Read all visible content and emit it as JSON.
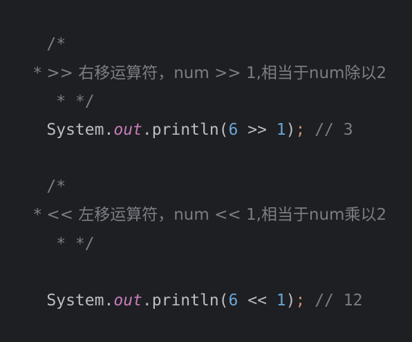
{
  "editor": {
    "lines": [
      {
        "text": "/*"
      },
      {
        "text": " * >> 右移运算符，num >> 1,相当于num除以2"
      },
      {
        "text": " * */"
      },
      {
        "tokens": {
          "cls": "System",
          "dot1": ".",
          "field": "out",
          "dot2": ".",
          "method": "println(",
          "n1": "6",
          "op": " >> ",
          "n2": "1",
          "close": ")",
          "semi": ";",
          "comment": " // 3"
        }
      },
      {
        "text": "/*"
      },
      {
        "text": " * << 左移运算符，num << 1,相当于num乘以2"
      },
      {
        "text": " * */"
      },
      {
        "tokens": {
          "cls": "System",
          "dot1": ".",
          "field": "out",
          "dot2": ".",
          "method": "println(",
          "n1": "6",
          "op": " << ",
          "n2": "1",
          "close": ")",
          "semi": ";",
          "comment": " // 12"
        }
      }
    ]
  },
  "colors": {
    "background": "#1e1f22",
    "default_text": "#bcbec4",
    "comment": "#7a7e85",
    "field": "#c77dbb",
    "number": "#6aa7d8",
    "semicolon": "#cf8e6d"
  }
}
